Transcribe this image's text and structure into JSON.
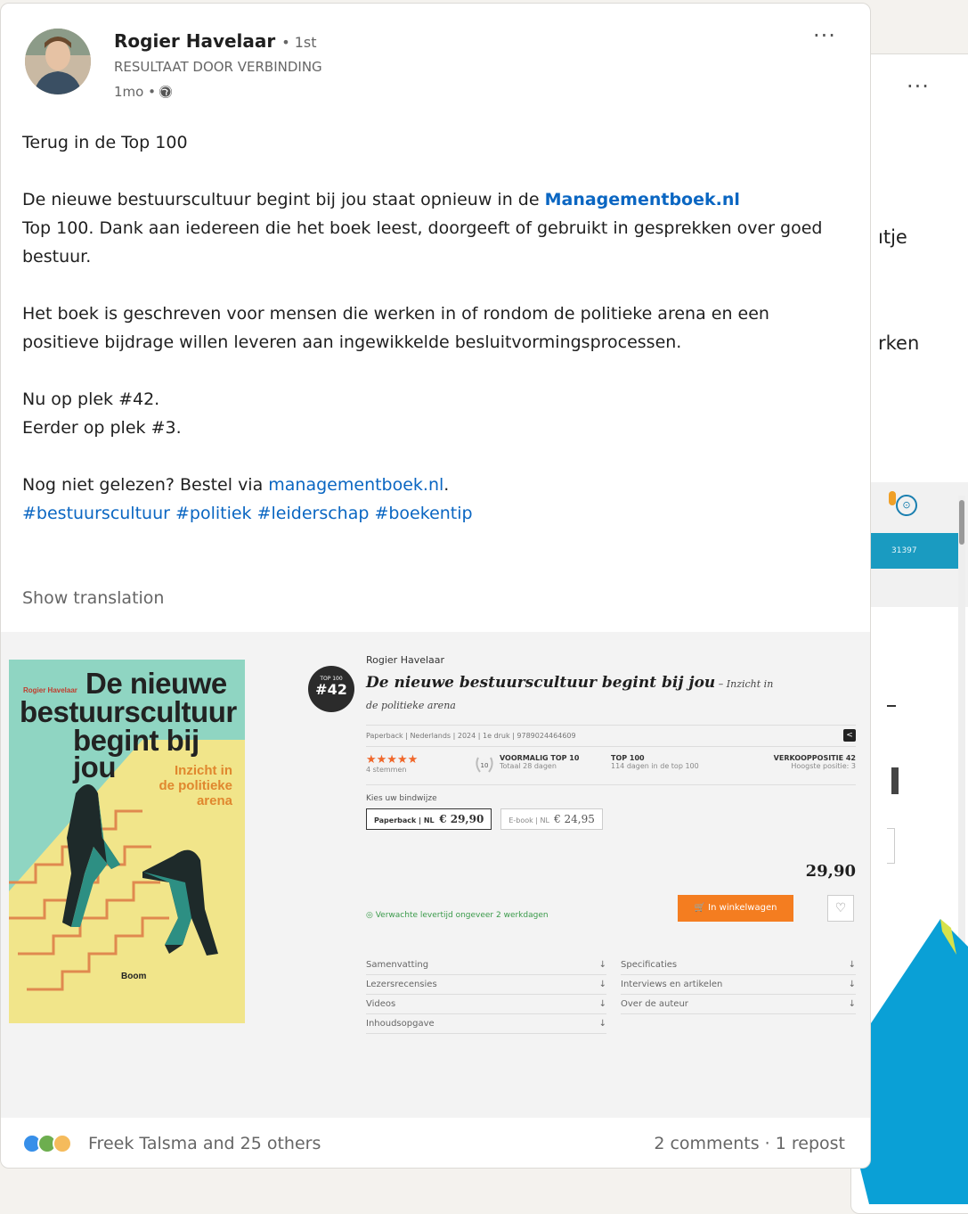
{
  "post": {
    "author": "Rogier Havelaar",
    "degree": "• 1st",
    "subtitle": "RESULTAAT DOOR VERBINDING",
    "time": "1mo •",
    "more": "···",
    "headline": "Terug in de Top 100",
    "p1_before": "De nieuwe bestuurscultuur begint bij jou staat opnieuw in de ",
    "p1_link": "Managementboek.nl",
    "p1_after": " Top 100. Dank aan iedereen die het boek leest, doorgeeft of gebruikt in gesprekken over goed bestuur.",
    "p2": "Het boek is geschreven voor mensen die werken in of rondom de politieke arena en een positieve bijdrage willen leveren aan ingewikkelde besluitvormingsprocessen.",
    "p3a": "Nu op plek #42.",
    "p3b": "Eerder op plek #3.",
    "p4_before": "Nog niet gelezen? Bestel via ",
    "p4_link": "managementboek.nl",
    "p4_after": ".",
    "hashtags": "#bestuurscultuur #politiek #leiderschap #boekentip",
    "show_translation": "Show translation"
  },
  "cover": {
    "author": "Rogier Havelaar",
    "title_l1": "De nieuwe",
    "title_l2": "bestuurscultuur",
    "title_l3": "begint bij jou",
    "subtitle_l1": "Inzicht in",
    "subtitle_l2": "de politieke",
    "subtitle_l3": "arena",
    "publisher": "Boom"
  },
  "product": {
    "badge_top": "TOP 100",
    "badge_rank": "#42",
    "author": "Rogier Havelaar",
    "title": "De nieuwe bestuurscultuur begint bij jou",
    "subtitle_l1": " – Inzicht in",
    "subtitle_l2": "de politieke arena",
    "meta": "Paperback | Nederlands | 2024 | 1e druk | 9789024464609",
    "stars": "★★★★★",
    "votes": "4 stemmen",
    "laurel": "10",
    "s1_title": "VOORMALIG TOP 10",
    "s1_sub": "Totaal 28 dagen",
    "s2_title": "TOP 100",
    "s2_sub": "114 dagen in de top 100",
    "s3_title": "VERKOOPPOSITIE 42",
    "s3_sub": "Hoogste positie: 3",
    "binding_label": "Kies uw bindwijze",
    "opt1_label": "Paperback | NL",
    "opt1_price": "€ 29,90",
    "opt2_label": "E-book | NL",
    "opt2_price": "€ 24,95",
    "price": "29,90",
    "delivery": "Verwachte levertijd ongeveer 2 werkdagen",
    "cart_button": "In winkelwagen",
    "acc": [
      "Samenvatting",
      "Lezersrecensies",
      "Videos",
      "Inhoudsopgave"
    ],
    "acc_right": [
      "Specificaties",
      "Interviews en artikelen",
      "Over de auteur"
    ]
  },
  "footer": {
    "reactions": "Freek Talsma and 25 others",
    "comments": "2 comments · 1 repost"
  },
  "background_card": {
    "more": "···",
    "frag1": "ıtje",
    "frag2": "rken",
    "code": "31397"
  },
  "colors": {
    "link": "#0a66c2",
    "cta": "#f47d20",
    "product_bar": "#1a9bc1"
  }
}
